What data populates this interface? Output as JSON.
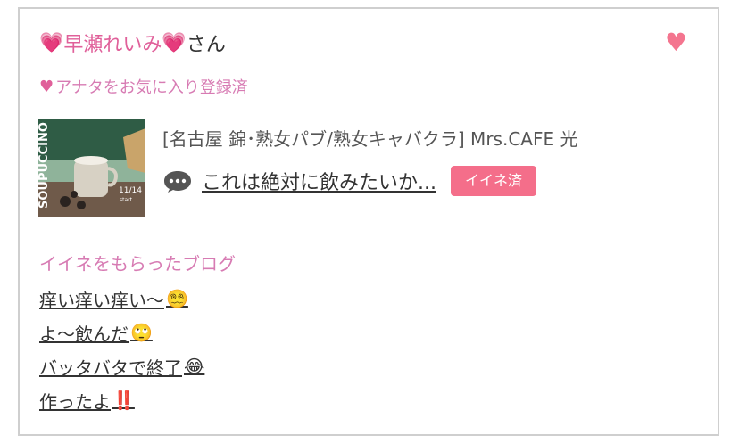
{
  "header": {
    "heart_left": "💗",
    "user_name": "早瀬れいみ",
    "heart_right": "💗",
    "honorific": "さん",
    "fav_heart": "♥"
  },
  "favorite_status": {
    "heart": "♥",
    "label": "アナタをお気に入り登録済"
  },
  "post": {
    "shop": "[名古屋 錦･熟女パブ/熟女キャバクラ]  Mrs.CAFE 光",
    "title": "これは絶対に飲みたいか...",
    "like_badge": "イイネ済",
    "thumb_text": "SOUPUCCINO",
    "thumb_date": "11/14",
    "thumb_start": "start"
  },
  "liked_blogs": {
    "title": "イイネをもらったブログ",
    "items": [
      {
        "text": "痒い痒い痒い〜",
        "emoji": "😵‍💫"
      },
      {
        "text": "よ〜飲んだ",
        "emoji": "🙄"
      },
      {
        "text": "バッタバタで終了",
        "emoji": "😂"
      },
      {
        "text": "作ったよ",
        "emoji": "‼️"
      }
    ]
  },
  "colors": {
    "pink_text": "#d77bb3",
    "badge": "#f46e8a",
    "heart": "#f4758f"
  }
}
